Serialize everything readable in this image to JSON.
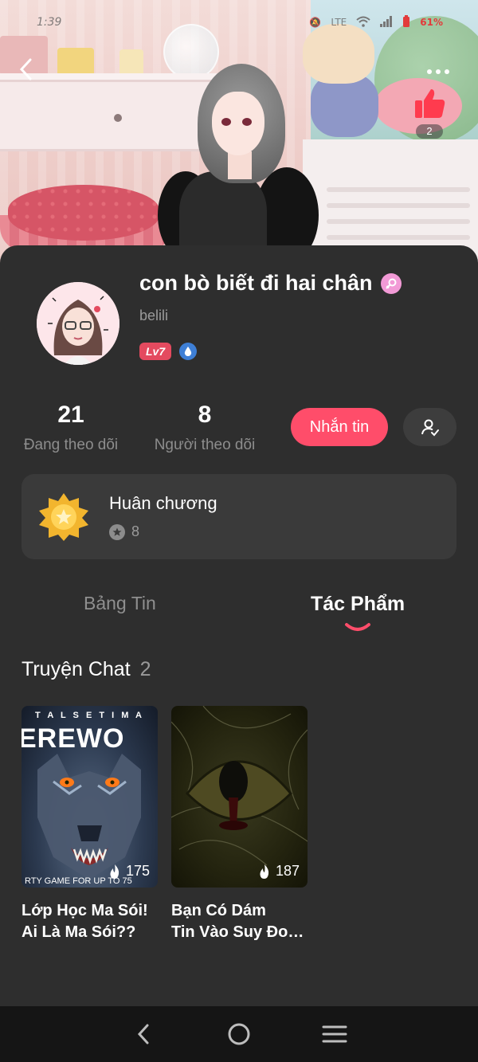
{
  "status_bar": {
    "time": "1:39",
    "network": "LTE",
    "battery": "61%"
  },
  "header": {
    "like_count": "2"
  },
  "profile": {
    "name": "con bò biết đi hai chân",
    "handle": "belili",
    "level": "Lv7"
  },
  "stats": {
    "following_count": "21",
    "following_label": "Đang theo dõi",
    "followers_count": "8",
    "followers_label": "Người theo dõi"
  },
  "actions": {
    "message_label": "Nhắn tin"
  },
  "medal": {
    "title": "Huân chương",
    "count": "8"
  },
  "tabs": [
    {
      "label": "Bảng Tin",
      "active": false
    },
    {
      "label": "Tác Phẩm",
      "active": true
    }
  ],
  "section": {
    "title": "Truyện Chat",
    "count": "2"
  },
  "stories": [
    {
      "title_line1": "Lớp Học Ma Sói!",
      "title_line2": "Ai Là Ma Sói??",
      "views": "175",
      "cover_top_text": "T A L S E T I M A",
      "cover_title": "EREWO",
      "cover_bottom_text": "RTY GAME FOR UP TO 75"
    },
    {
      "title_line1": "Bạn Có Dám",
      "title_line2": "Tin Vào Suy Đo…",
      "views": "187"
    }
  ],
  "colors": {
    "accent": "#ff4d6a",
    "background": "#2e2e2e",
    "card": "#3a3a3a",
    "level_badge": "#e44a5f"
  }
}
